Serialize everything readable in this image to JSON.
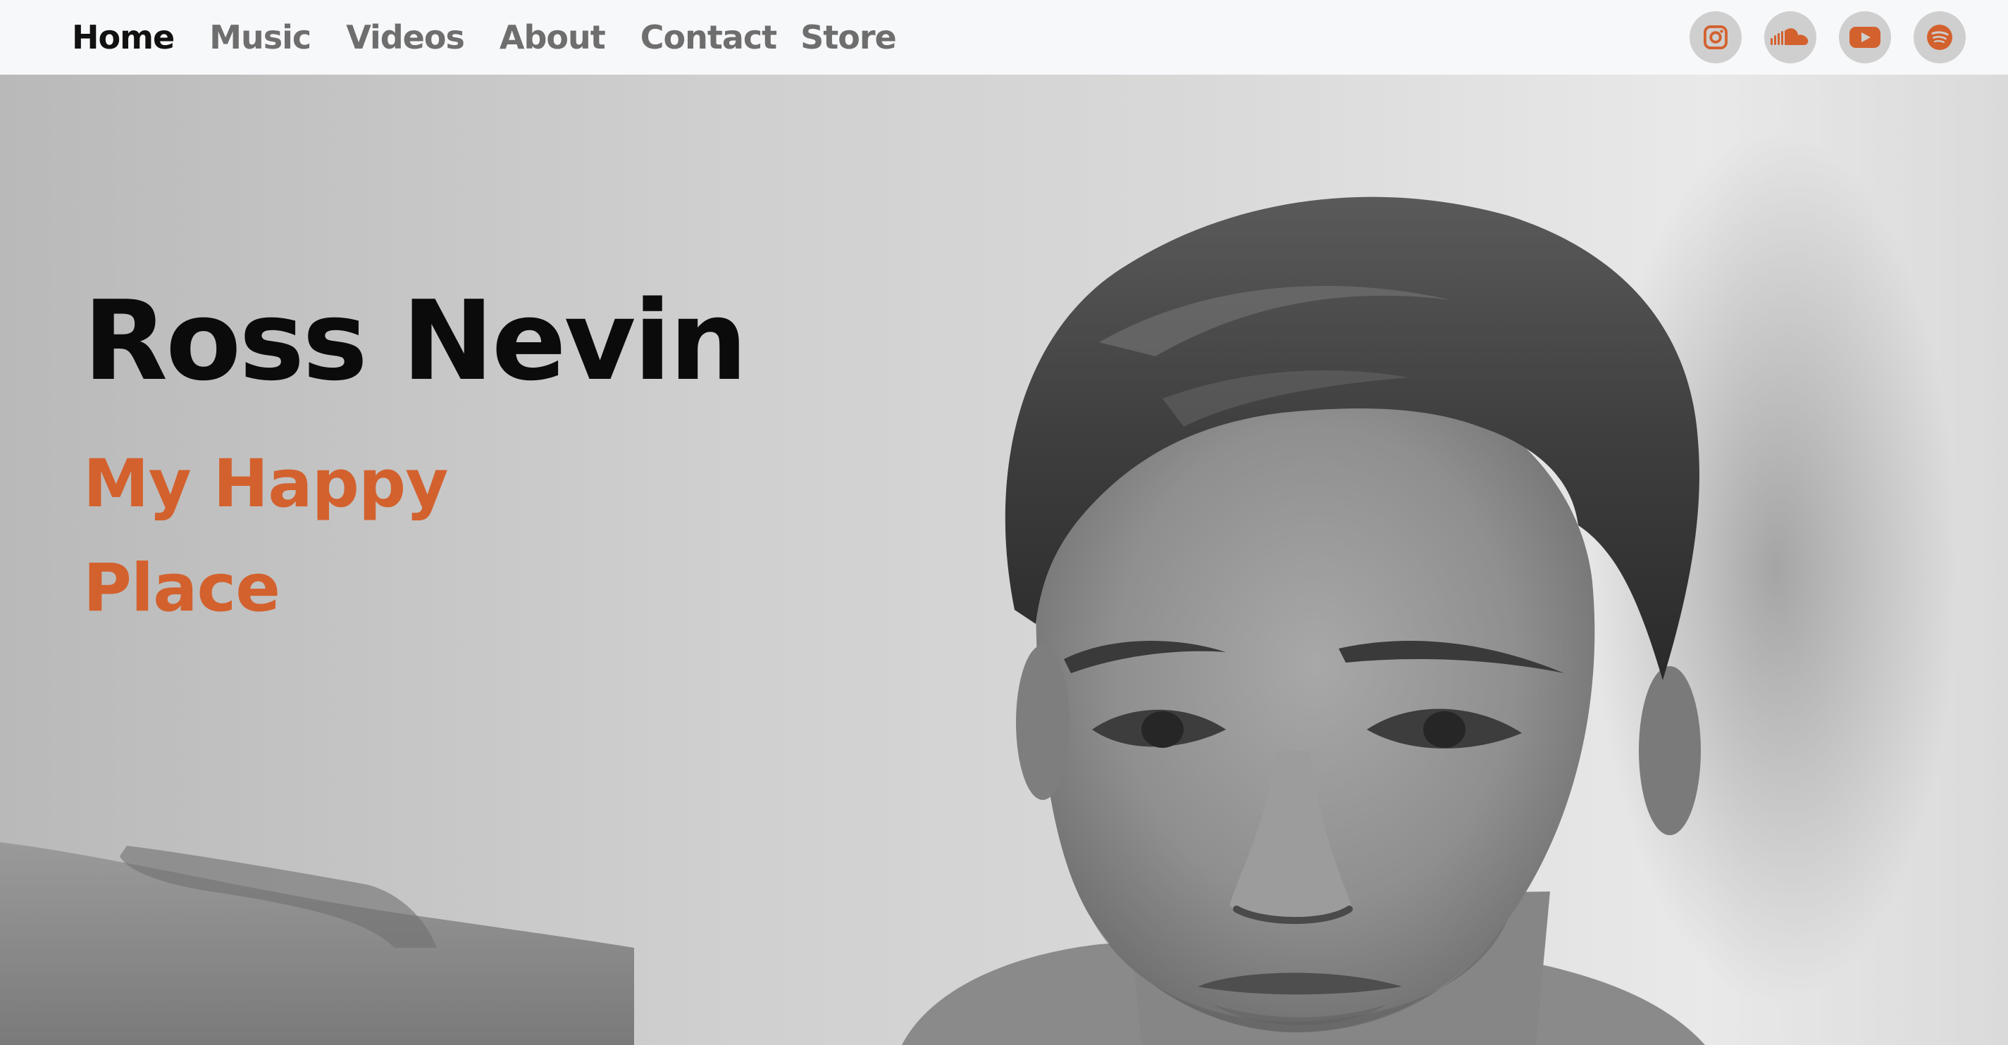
{
  "nav": {
    "links": [
      {
        "label": "Home",
        "active": true
      },
      {
        "label": "Music",
        "active": false
      },
      {
        "label": "Videos",
        "active": false
      },
      {
        "label": "About",
        "active": false
      },
      {
        "label": "Contact",
        "active": false
      },
      {
        "label": "Store",
        "active": false
      }
    ]
  },
  "social": {
    "icons": [
      "instagram-icon",
      "soundcloud-icon",
      "youtube-icon",
      "spotify-icon"
    ],
    "icon_color": "#d3612e",
    "button_bg": "#cfcfcf"
  },
  "hero": {
    "title": "Ross Nevin",
    "subtitle": "My Happy Place",
    "title_color": "#0b0b0b",
    "subtitle_color": "#d3612e"
  },
  "colors": {
    "accent": "#d3612e",
    "nav_bg": "#f7f8fa",
    "nav_text": "#6e6e6e",
    "nav_active": "#111111"
  }
}
